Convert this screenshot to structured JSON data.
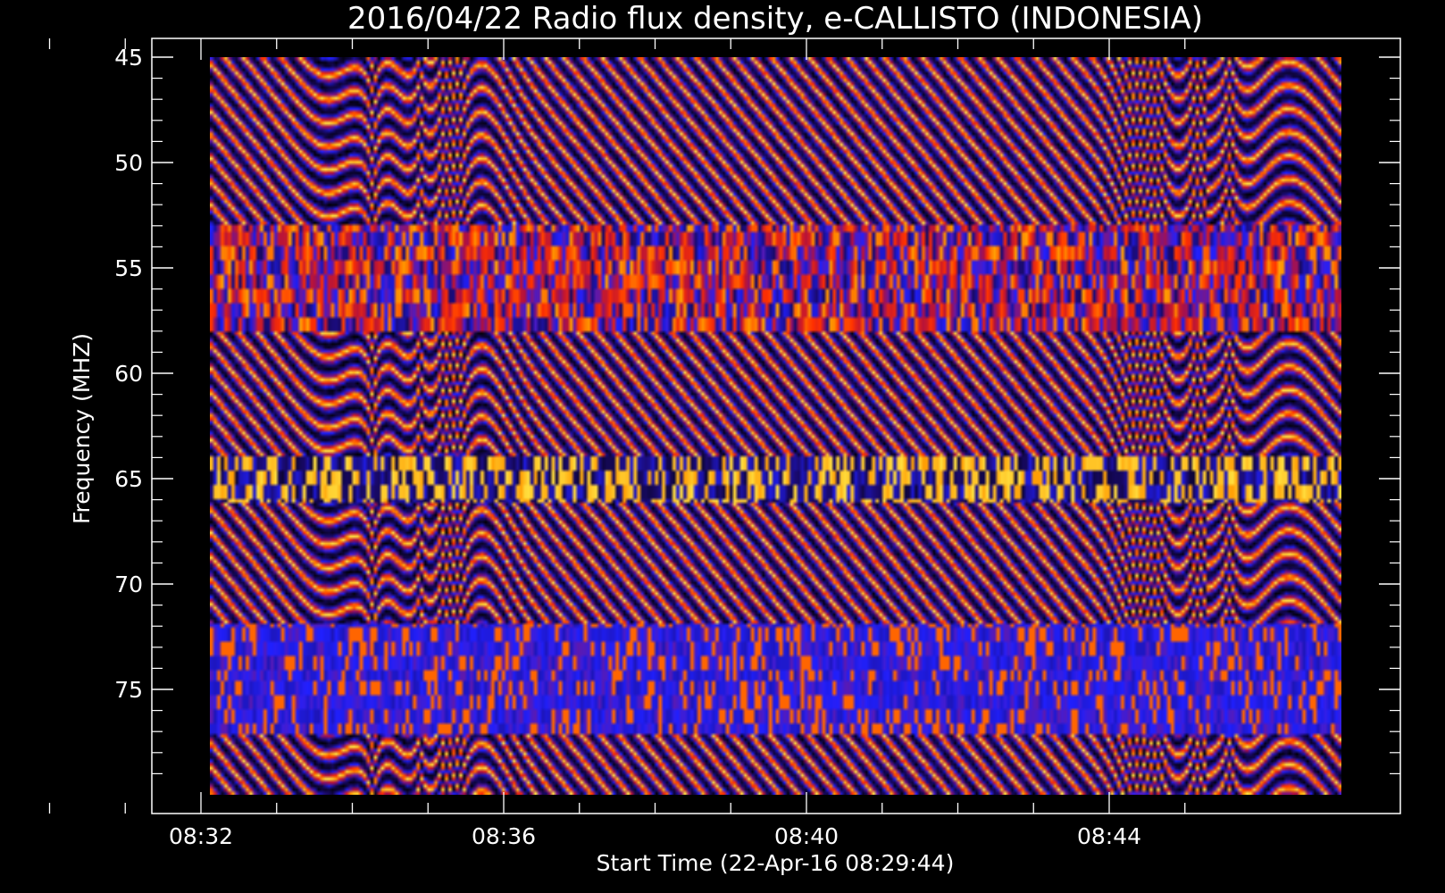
{
  "chart_data": {
    "type": "heatmap",
    "title": "2016/04/22  Radio flux density, e-CALLISTO (INDONESIA)",
    "xlabel": "Start Time (22-Apr-16 08:29:44)",
    "ylabel": "Frequency (MHZ)",
    "x_tick_labels": [
      "08:32",
      "08:36",
      "08:40",
      "08:44"
    ],
    "x_ticks_minutes": [
      32,
      36,
      40,
      44
    ],
    "xlim_minutes": [
      29.73,
      45.0
    ],
    "y_tick_labels": [
      "45",
      "50",
      "55",
      "60",
      "65",
      "70",
      "75"
    ],
    "y_ticks": [
      45,
      50,
      55,
      60,
      65,
      70,
      75
    ],
    "ylim": [
      45,
      80
    ],
    "y_inverted": true,
    "colormap": [
      "#000000",
      "#1a0a6e",
      "#2020ff",
      "#b01040",
      "#ff3000",
      "#ff9a00",
      "#ffe040"
    ],
    "interference_bands_mhz": [
      [
        53.0,
        58.0
      ],
      [
        64.0,
        66.2
      ],
      [
        71.8,
        77.2
      ]
    ],
    "background": "#000000",
    "axes_color": "#ffffff"
  }
}
